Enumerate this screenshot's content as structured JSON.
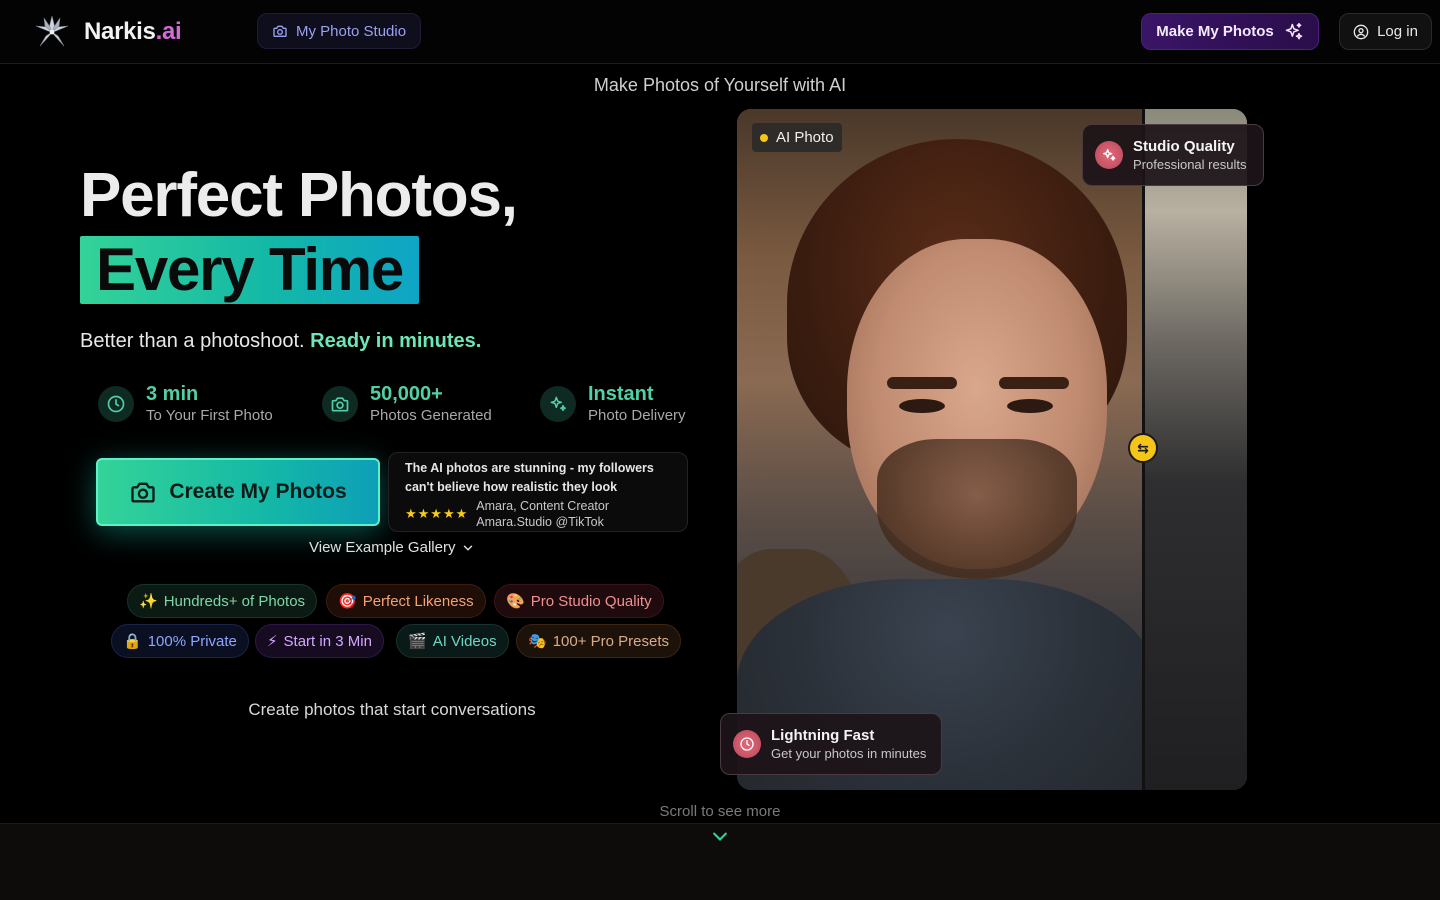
{
  "nav": {
    "brand_main": "Narkis",
    "brand_ai": ".ai",
    "studio_label": "My Photo Studio",
    "make_label": "Make My Photos",
    "login_label": "Log in"
  },
  "tagline": "Make Photos of Yourself with AI",
  "hero": {
    "title_line1": "Perfect Photos,",
    "title_line2": "Every Time",
    "sub_plain": "Better than a photoshoot. ",
    "sub_highlight": "Ready in minutes",
    "sub_end": ".",
    "stats": [
      {
        "value": "3 min",
        "label": "To Your First Photo",
        "icon": "clock-icon"
      },
      {
        "value": "50,000+",
        "label": "Photos Generated",
        "icon": "camera-icon"
      },
      {
        "value": "Instant",
        "label": "Photo Delivery",
        "icon": "sparkles-icon"
      }
    ],
    "cta_label": "Create My Photos",
    "gallery_label": "View Example Gallery",
    "conversation_text": "Create photos that start conversations"
  },
  "testimonial": {
    "quote": "The AI photos are stunning - my followers can't believe how realistic they look",
    "stars": "★★★★★",
    "author": "Amara, Content Creator",
    "handle": "Amara.Studio @TikTok"
  },
  "pills": [
    {
      "emoji": "✨",
      "label": "Hundreds+ of Photos"
    },
    {
      "emoji": "🎯",
      "label": "Perfect Likeness"
    },
    {
      "emoji": "🎨",
      "label": "Pro Studio Quality"
    },
    {
      "emoji": "🔒",
      "label": "100% Private"
    },
    {
      "emoji": "⚡",
      "label": "Start in 3 Min"
    },
    {
      "emoji": "🎬",
      "label": "AI Videos"
    },
    {
      "emoji": "🎭",
      "label": "100+ Pro Presets"
    }
  ],
  "photo": {
    "tag_label": "AI Photo",
    "handle_glyph": "⇆",
    "card_top": {
      "title": "Studio Quality",
      "subtitle": "Professional results"
    },
    "card_bottom": {
      "title": "Lightning Fast",
      "subtitle": "Get your photos in minutes"
    }
  },
  "scroll_hint": "Scroll to see more",
  "colors": {
    "accent_green": "#34d399",
    "accent_teal": "#14b8a6",
    "brand_purple": "#3a1566",
    "brand_pink": "#d36bd8",
    "star_yellow": "#facc15"
  }
}
